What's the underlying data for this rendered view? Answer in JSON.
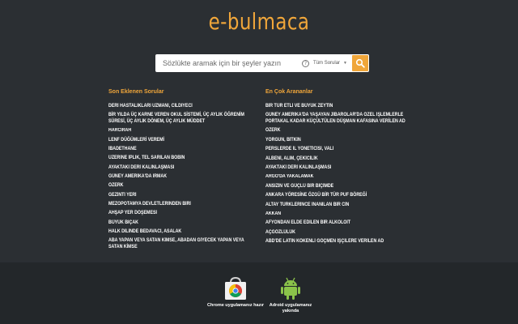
{
  "logo": "e-bulmaca",
  "search": {
    "placeholder": "Sözlükte aramak için bir şeyler yazın",
    "help": "?",
    "filter_label": "Tüm Sorular"
  },
  "left": {
    "title": "Son Eklenen Sorular",
    "items": [
      "DERİ HASTALIKLARI UZMANI, CİLDİYECİ",
      "BİR YILDA ÜÇ KARNE VEREN OKUL SİSTEMİ, ÜÇ AYLIK ÖĞRENİM SÜRESİ, ÜÇ AYLIK DÖNEM, ÜÇ AYLIK MÜDDET",
      "HARCIRAH",
      "LENF DÜĞÜMLERİ VEREMİ",
      "İBADETHANE",
      "ÜZERİNE İPLİK, TEL SARILAN BOBİN",
      "AYAKTAKİ DERİ KALINLAŞMASI",
      "GÜNEY AMERİKA'DA IRMAK",
      "ÖZERK",
      "GEZİNTİ YERİ",
      "MEZOPOTAMYA DEVLETLERİNDEN BİRİ",
      "AHŞAP YER DÖŞEMESİ",
      "BÜYÜK BIÇAK",
      "HALK DİLİNDE BEDAVACI, ASALAK",
      "ABA YAPAN VEYA SATAN KİMSE, ABADAN GİYECEK YAPAN VEYA SATAN KİMSE"
    ]
  },
  "right": {
    "title": "En Çok Arananlar",
    "items": [
      "BİR TÜR ETLİ VE BÜYÜK ZEYTİN",
      "GÜNEY AMERİKA'DA YAŞAYAN JİBAROLAR'DA ÖZEL İŞLEMLERLE PORTAKAL KADAR KÜÇÜLTÜLEN DÜŞMAN KAFASINA VERİLEN AD",
      "ÖZERK",
      "YORGUN, BİTKİN",
      "PERSLERDE İL YÖNETİCİSİ, VALİ",
      "ALBENİ, ALIM, ÇEKİCİLİK",
      "AYAKTAKİ DERİ KALINLAŞMASI",
      "ARGO'DA YAKALAMAK",
      "ANSIZIN VE GÜÇLÜ BİR BİÇİMDE",
      "ANKARA YÖRESİNE ÖZGÜ BİR TÜR PUF BÖREĞİ",
      "ALTAY TÜRKLERİNCE İNANILAN BİR CİN",
      "AKKAN",
      "AFYONDAN ELDE EDİLEN BİR ALKOLOİT",
      "AÇGÖZLÜLÜK",
      "ABD'DE LATİN KÖKENLİ GÖÇMEN İŞÇİLERE VERİLEN AD"
    ]
  },
  "apps": {
    "chrome_label": "Chrome uygulamanız hazır",
    "android_label": "Adroid uygulamanız yakında"
  },
  "colors": {
    "accent": "#f0a63a",
    "background": "#2b2f33",
    "footer": "#23272a",
    "android": "#8bc34a"
  },
  "icons": [
    "help-icon",
    "search-icon",
    "chevron-down-icon",
    "chrome-store-icon",
    "android-icon"
  ]
}
